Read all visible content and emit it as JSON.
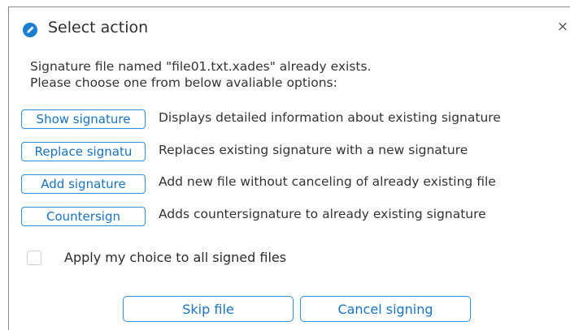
{
  "dialog": {
    "title": "Select action",
    "close_glyph": "×",
    "app_icon": "signature-app-icon",
    "accent_color": "#2f8fd6"
  },
  "message": {
    "line1": "Signature file named \"file01.txt.xades\" already exists.",
    "line2": "Please choose one from below avaliable options:"
  },
  "options": [
    {
      "button": "Show signature",
      "description": "Displays detailed information about existing signature"
    },
    {
      "button": "Replace signatu",
      "description": "Replaces existing signature with a new signature"
    },
    {
      "button": "Add signature",
      "description": "Add new file without canceling of already existing file"
    },
    {
      "button": "Countersign",
      "description": "Adds countersignature to already existing signature"
    }
  ],
  "apply_all": {
    "label": "Apply my choice to all signed files",
    "checked": false
  },
  "footer": {
    "skip_label": "Skip file",
    "cancel_label": "Cancel signing"
  }
}
